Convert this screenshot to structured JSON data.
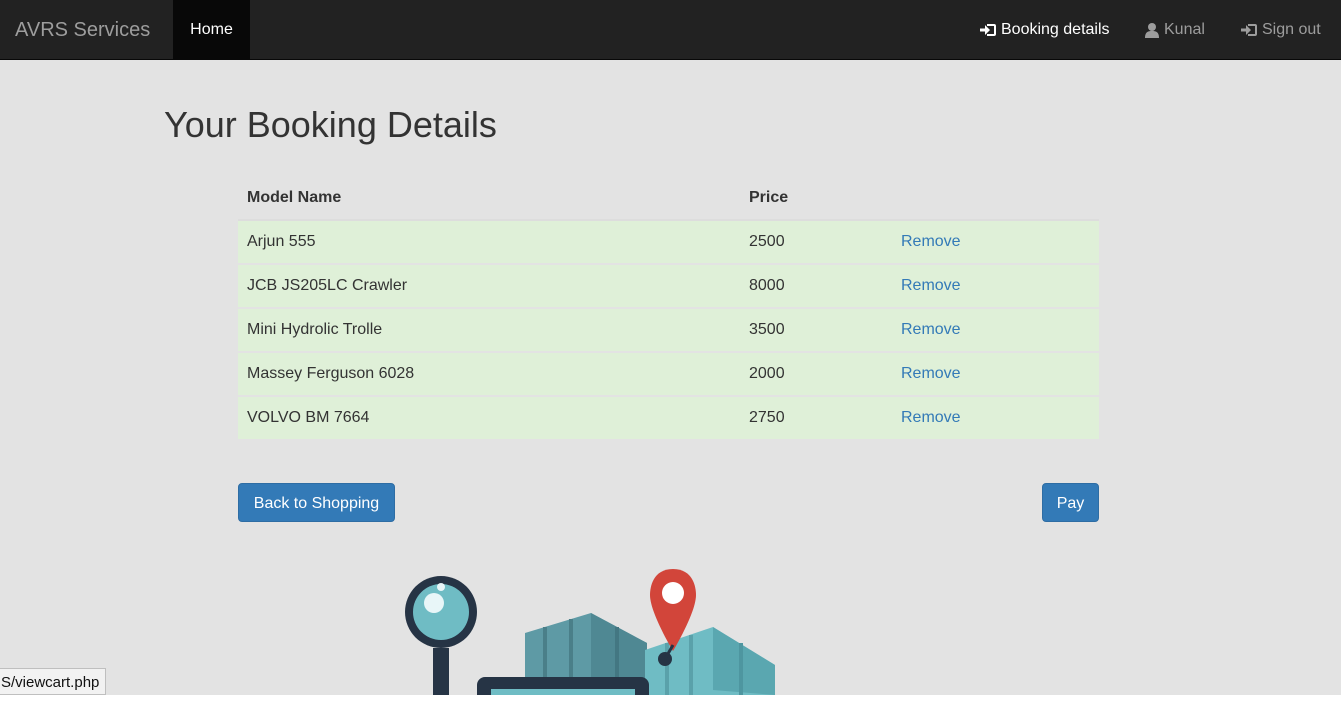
{
  "navbar": {
    "brand": "AVRS Services",
    "home": "Home",
    "booking_details": "Booking details",
    "user": "Kunal",
    "sign_out": "Sign out",
    "icons": {
      "booking": "login-arrow-icon",
      "user": "user-icon",
      "signout": "login-arrow-icon"
    }
  },
  "page": {
    "title": "Your Booking Details"
  },
  "cart": {
    "headers": {
      "model": "Model Name",
      "price": "Price"
    },
    "rows": [
      {
        "model": "Arjun 555",
        "price": "2500",
        "action": "Remove"
      },
      {
        "model": "JCB JS205LC Crawler",
        "price": "8000",
        "action": "Remove"
      },
      {
        "model": "Mini Hydrolic Trolle",
        "price": "3500",
        "action": "Remove"
      },
      {
        "model": "Massey Ferguson 6028",
        "price": "2000",
        "action": "Remove"
      },
      {
        "model": "VOLVO BM 7664",
        "price": "2750",
        "action": "Remove"
      }
    ]
  },
  "buttons": {
    "back": "Back to Shopping",
    "pay": "Pay"
  },
  "status_bar": {
    "url": "S/viewcart.php"
  },
  "colors": {
    "navbar": "#222222",
    "row_success": "#dff0d8",
    "link": "#337ab7",
    "primary_button": "#337ab7",
    "background": "#e3e3e3"
  }
}
